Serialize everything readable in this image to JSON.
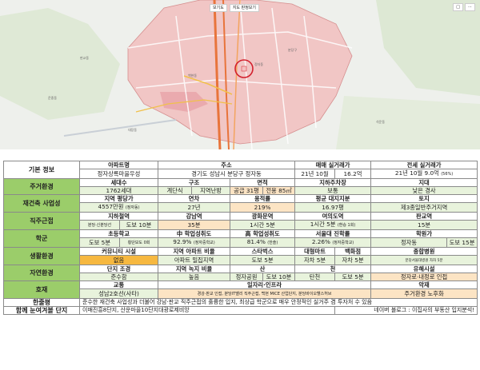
{
  "map": {
    "controls": [
      "보기도",
      "지도 판정보기"
    ],
    "tools": [
      "□",
      "⋯"
    ],
    "labels": [
      "판교동",
      "운중동",
      "백현동",
      "정자동",
      "분당구",
      "대장동",
      "석운동"
    ],
    "road_color": "#e8743b",
    "district_color": "#f2b8b8",
    "marker_color": "#d3202d"
  },
  "rows": {
    "basic": {
      "cat": "기본 정보",
      "h_name": "아파트명",
      "name": "정자상록마을우성",
      "h_addr": "주소",
      "addr": "경기도 성남시 분당구 정자동",
      "h_sale": "매매 실거래가",
      "sale_date": "21년 10월",
      "sale_price": "16.2억",
      "h_lease": "전세 실거래가",
      "lease_date": "21년 10월",
      "lease_price": "9.0억",
      "lease_ratio": "(56%)"
    },
    "env": {
      "cat": "주거환경",
      "h_house": "세대수",
      "house": "1762세대",
      "h_struct": "구조",
      "struct_a": "계단식",
      "struct_b": "지역난방",
      "h_area": "면적",
      "area_a": "공급 31평",
      "area_b": "전용 85㎡",
      "h_park": "지하주차장",
      "park": "보통",
      "h_terrain": "지대",
      "terrain": "낮은 경사"
    },
    "rebuild": {
      "cat": "재건축 사업성",
      "h_price": "지역 평당가",
      "price": "4557만원",
      "price_note": "(정자동)",
      "h_year": "연차",
      "year": "27년",
      "h_far": "용적률",
      "far": "219%",
      "h_land": "평균 대지지분",
      "land": "16.97평",
      "h_zone": "토지",
      "zone": "제3종일반주거지역"
    },
    "commute": {
      "cat": "직주근접",
      "h_subway": "지하철역",
      "subway_a": "분당·신분당선",
      "subway_b": "도보 10분",
      "h_gangnam": "강남역",
      "gangnam": "35분",
      "h_gwanghwa": "광화문역",
      "gwanghwa": "1시간 5분",
      "h_yeoui": "여의도역",
      "yeoui": "1시간 5분",
      "yeoui_note": "(환승 1회)",
      "h_pangyo": "판교역",
      "pangyo": "15분"
    },
    "school": {
      "cat": "학군",
      "h_elem": "초등학교",
      "elem_a": "도보 5분",
      "elem_b": "횡단보도 0회",
      "h_mid": "中 학업성취도",
      "mid": "92.9%",
      "mid_note": "(정자중학교)",
      "h_high": "高 학업성취도",
      "high": "81.4%",
      "high_note": "(한솔)",
      "h_snu": "서울대 진학률",
      "snu": "2.26%",
      "snu_note": "(정자중학교)",
      "h_academy": "학원가",
      "academy_a": "정자동",
      "academy_b": "도보 15분"
    },
    "life": {
      "cat": "생활환경",
      "h_comm": "커뮤니티 시설",
      "comm": "없음",
      "h_ratio": "지역 아파트 비율",
      "ratio": "아파트 밀집지역",
      "h_star": "스타벅스",
      "star": "도보 5분",
      "h_mart": "대형마트",
      "mart": "자차 5분",
      "h_dept": "백화점",
      "dept": "자차 5분",
      "h_hosp": "종합병원",
      "hosp": "분당서울대병원 자차 5분"
    },
    "nature": {
      "cat": "자연환경",
      "h_landscape": "단지 조경",
      "landscape": "준수함",
      "h_green": "지역 녹지 비율",
      "green": "높음",
      "h_mountain": "산",
      "mountain_a": "정자공원",
      "mountain_b": "도보 10분",
      "h_stream": "천",
      "stream_a": "탄천",
      "stream_b": "도보 5분",
      "h_hazard": "유해시설",
      "hazard": "정자로·내정로 인접"
    },
    "good": {
      "cat": "호재",
      "h_traffic": "교통",
      "traffic": "성남2호선(사타)",
      "h_jobs": "일자리·인프라",
      "jobs": "경강·판교 인접, 분당IT밸리 직주근접, 백현 MICE 산업단지, 분당바이오헬스허브",
      "h_bad": "악재",
      "bad": "주거환경 노후화"
    },
    "summary": {
      "cat": "한줄평",
      "text": "준수한 재건축 사업성과 더불어 강남·판교 직주근접의 훌륭한 입지, 최상급 학군으로 매우 안정적인 실거주 겸 투자처 수 있음"
    },
    "compare": {
      "cat": "함께 눈여겨볼 단지",
      "text": "이매진흥8단지, 산운마을10단지대광로제비앙",
      "blog": "네이버 블로그 : 이집사의 부동산 입지분석!"
    }
  }
}
